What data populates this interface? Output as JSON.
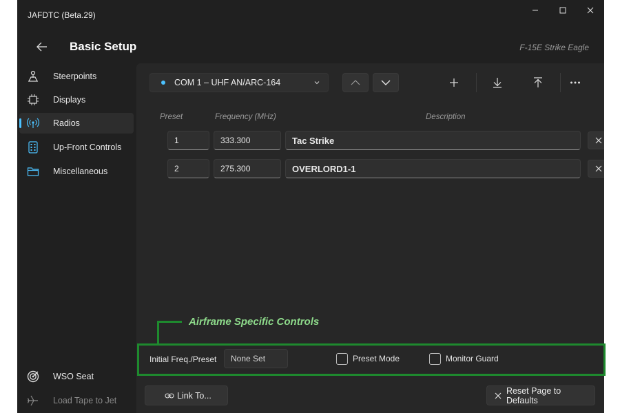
{
  "window": {
    "app_title": "JAFDTC (Beta.29)"
  },
  "header": {
    "page_title": "Basic Setup",
    "airframe": "F-15E Strike Eagle"
  },
  "sidebar": {
    "items": [
      {
        "label": "Steerpoints",
        "icon": "steerpoint-icon"
      },
      {
        "label": "Displays",
        "icon": "chip-icon"
      },
      {
        "label": "Radios",
        "icon": "radio-antenna-icon",
        "active": true
      },
      {
        "label": "Up-Front Controls",
        "icon": "calculator-icon"
      },
      {
        "label": "Miscellaneous",
        "icon": "folder-icon"
      }
    ],
    "bottom_items": [
      {
        "label": "WSO Seat",
        "icon": "target-icon"
      },
      {
        "label": "Load Tape to Jet",
        "icon": "airplane-icon",
        "disabled": true
      }
    ]
  },
  "radio_selector": {
    "selected": "COM 1 – UHF AN/ARC-164"
  },
  "table": {
    "headers": {
      "preset": "Preset",
      "frequency": "Frequency (MHz)",
      "description": "Description"
    },
    "rows": [
      {
        "preset": "1",
        "frequency": "333.300",
        "description": "Tac Strike"
      },
      {
        "preset": "2",
        "frequency": "275.300",
        "description": "OVERLORD1-1"
      }
    ]
  },
  "annotation": {
    "label": "Airframe Specific Controls"
  },
  "airframe_controls": {
    "initial_label": "Initial Freq./Preset",
    "initial_value": "None Set",
    "preset_mode_label": "Preset Mode",
    "monitor_guard_label": "Monitor Guard"
  },
  "footer": {
    "link_label": "Link To...",
    "reset_label": "Reset Page to Defaults"
  },
  "colors": {
    "accent": "#4cc2ff",
    "annotation_green": "#1e8a2e",
    "annotation_text": "#8dd98a"
  }
}
